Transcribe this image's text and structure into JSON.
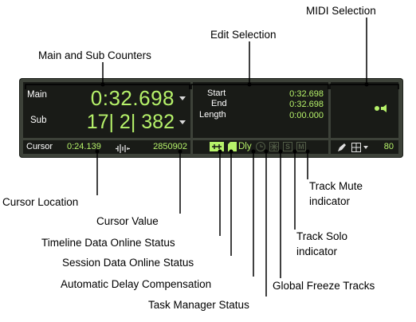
{
  "callouts": {
    "midi_selection": "MIDI Selection",
    "edit_selection": "Edit Selection",
    "main_sub_counters": "Main and Sub Counters",
    "cursor_location": "Cursor Location",
    "cursor_value": "Cursor Value",
    "timeline_data": "Timeline Data Online Status",
    "session_data": "Session Data Online Status",
    "adc": "Automatic Delay Compensation",
    "task_manager": "Task Manager Status",
    "track_mute_1": "Track Mute",
    "track_mute_2": "indicator",
    "track_solo_1": "Track Solo",
    "track_solo_2": "indicator",
    "global_freeze": "Global Freeze Tracks"
  },
  "counters": {
    "main_label": "Main",
    "main_value": "0:32.698",
    "sub_label": "Sub",
    "sub_value": "17| 2| 382",
    "cursor_label": "Cursor",
    "cursor_location": "0:24.139",
    "cursor_value": "2850902"
  },
  "edit_selection": {
    "start_label": "Start",
    "start_value": "0:32.698",
    "end_label": "End",
    "end_value": "0:32.698",
    "length_label": "Length",
    "length_value": "0:00.000"
  },
  "status": {
    "delay_label": "Dly",
    "solo_letter": "S",
    "mute_letter": "M"
  },
  "midi": {
    "value": "80"
  },
  "colors": {
    "readout_green": "#b6f26a",
    "panel_body": "#3d4239",
    "section_bg": "#191b17"
  }
}
